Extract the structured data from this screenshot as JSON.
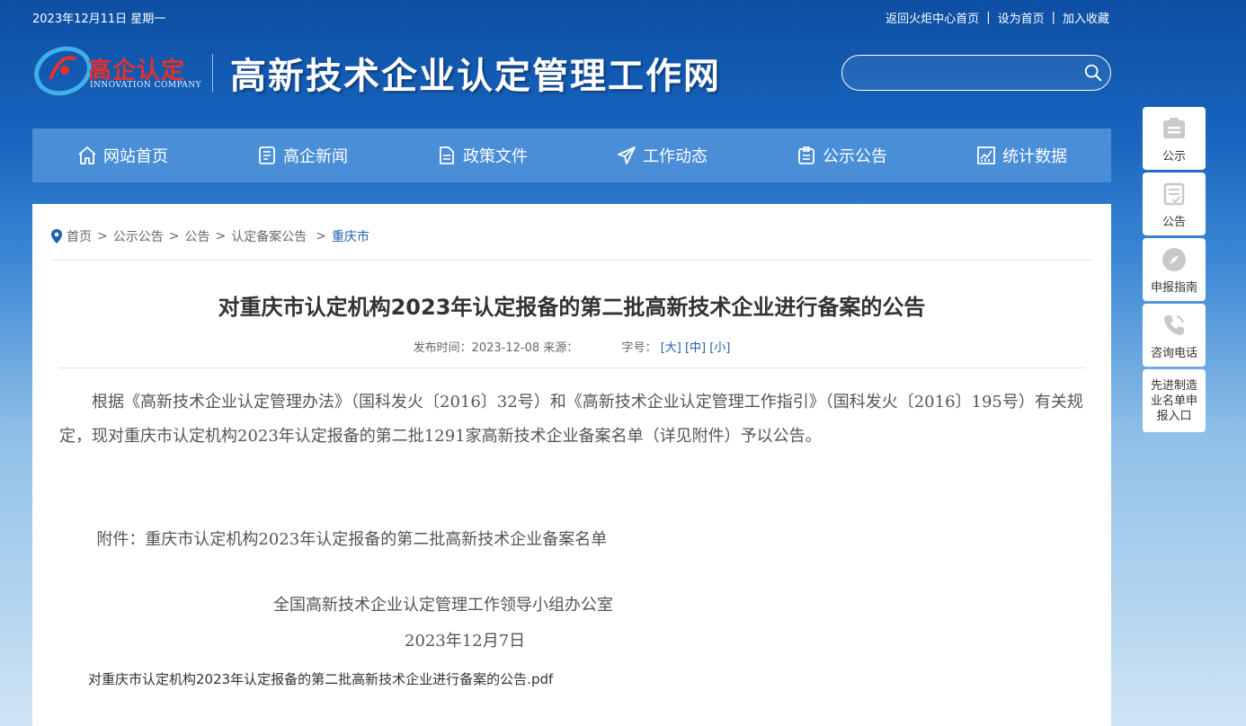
{
  "top": {
    "date": "2023年12月11日 星期一",
    "links": [
      "返回火炬中心首页",
      "设为首页",
      "加入收藏"
    ]
  },
  "logo": {
    "cn": "高企认定",
    "en": "INNOVATION COMPANY"
  },
  "site_title": "高新技术企业认定管理工作网",
  "search": {
    "value": ""
  },
  "nav": [
    "网站首页",
    "高企新闻",
    "政策文件",
    "工作动态",
    "公示公告",
    "统计数据"
  ],
  "breadcrumb": [
    "首页",
    "公示公告",
    "公告",
    "认定备案公告",
    "重庆市"
  ],
  "article": {
    "title": "对重庆市认定机构2023年认定报备的第二批高新技术企业进行备案的公告",
    "meta_time": "发布时间：2023-12-08 来源：",
    "meta_size_label": "字号：",
    "sizes": [
      "[大]",
      "[中]",
      "[小]"
    ],
    "para1": "根据《高新技术企业认定管理办法》（国科发火〔2016〕32号）和《高新技术企业认定管理工作指引》（国科发火〔2016〕195号）有关规定，现对重庆市认定机构2023年认定报备的第二批1291家高新技术企业备案名单（详见附件）予以公告。",
    "para2": "附件：重庆市认定机构2023年认定报备的第二批高新技术企业备案名单",
    "sign_org": "全国高新技术企业认定管理工作领导小组办公室",
    "sign_date": "2023年12月7日",
    "attachment": "对重庆市认定机构2023年认定报备的第二批高新技术企业进行备案的公告.pdf"
  },
  "sidebar": [
    "公示",
    "公告",
    "申报指南",
    "咨询电话",
    "先进制造业名单申报入口"
  ],
  "colors": {
    "nav_bg": "#4a8ed8",
    "link_blue": "#1f5fae",
    "logo_red": "#e4312b"
  }
}
